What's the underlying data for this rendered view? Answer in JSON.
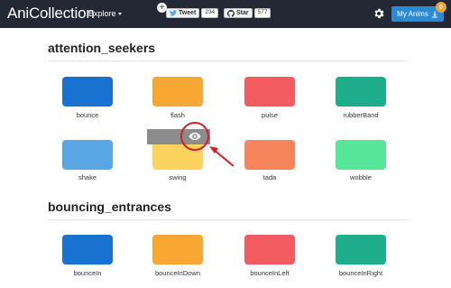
{
  "nav": {
    "brand": "AniCollection",
    "explore": "Explore",
    "tweet_label": "Tweet",
    "tweet_count": "234",
    "star_label": "Star",
    "star_count": "577",
    "my_anims_label": "My Anims",
    "my_anims_badge": "0"
  },
  "sections": [
    {
      "title": "attention_seekers",
      "items": [
        {
          "label": "bounce",
          "color": "#1a72d0"
        },
        {
          "label": "flash",
          "color": "#f8a734"
        },
        {
          "label": "pulse",
          "color": "#f25c60"
        },
        {
          "label": "rubberBand",
          "color": "#1fae8b"
        },
        {
          "label": "shake",
          "color": "#5aa5e3"
        },
        {
          "label": "swing",
          "color": "#fcd35f"
        },
        {
          "label": "tada",
          "color": "#f7855c"
        },
        {
          "label": "wobble",
          "color": "#58e69a"
        }
      ]
    },
    {
      "title": "bouncing_entrances",
      "items": [
        {
          "label": "bounceIn",
          "color": "#1a72d0"
        },
        {
          "label": "bounceInDown",
          "color": "#f8a734"
        },
        {
          "label": "bounceInLeft",
          "color": "#f25c60"
        },
        {
          "label": "bounceInRight",
          "color": "#1fae8b"
        }
      ]
    }
  ],
  "hover_overlay": {
    "add_icon": "plus-icon",
    "preview_icon": "eye-icon"
  },
  "colors": {
    "navbar": "#232834",
    "primary_button": "#2a8bd4",
    "badge": "#f0a23a",
    "annotation": "#d0202a"
  }
}
